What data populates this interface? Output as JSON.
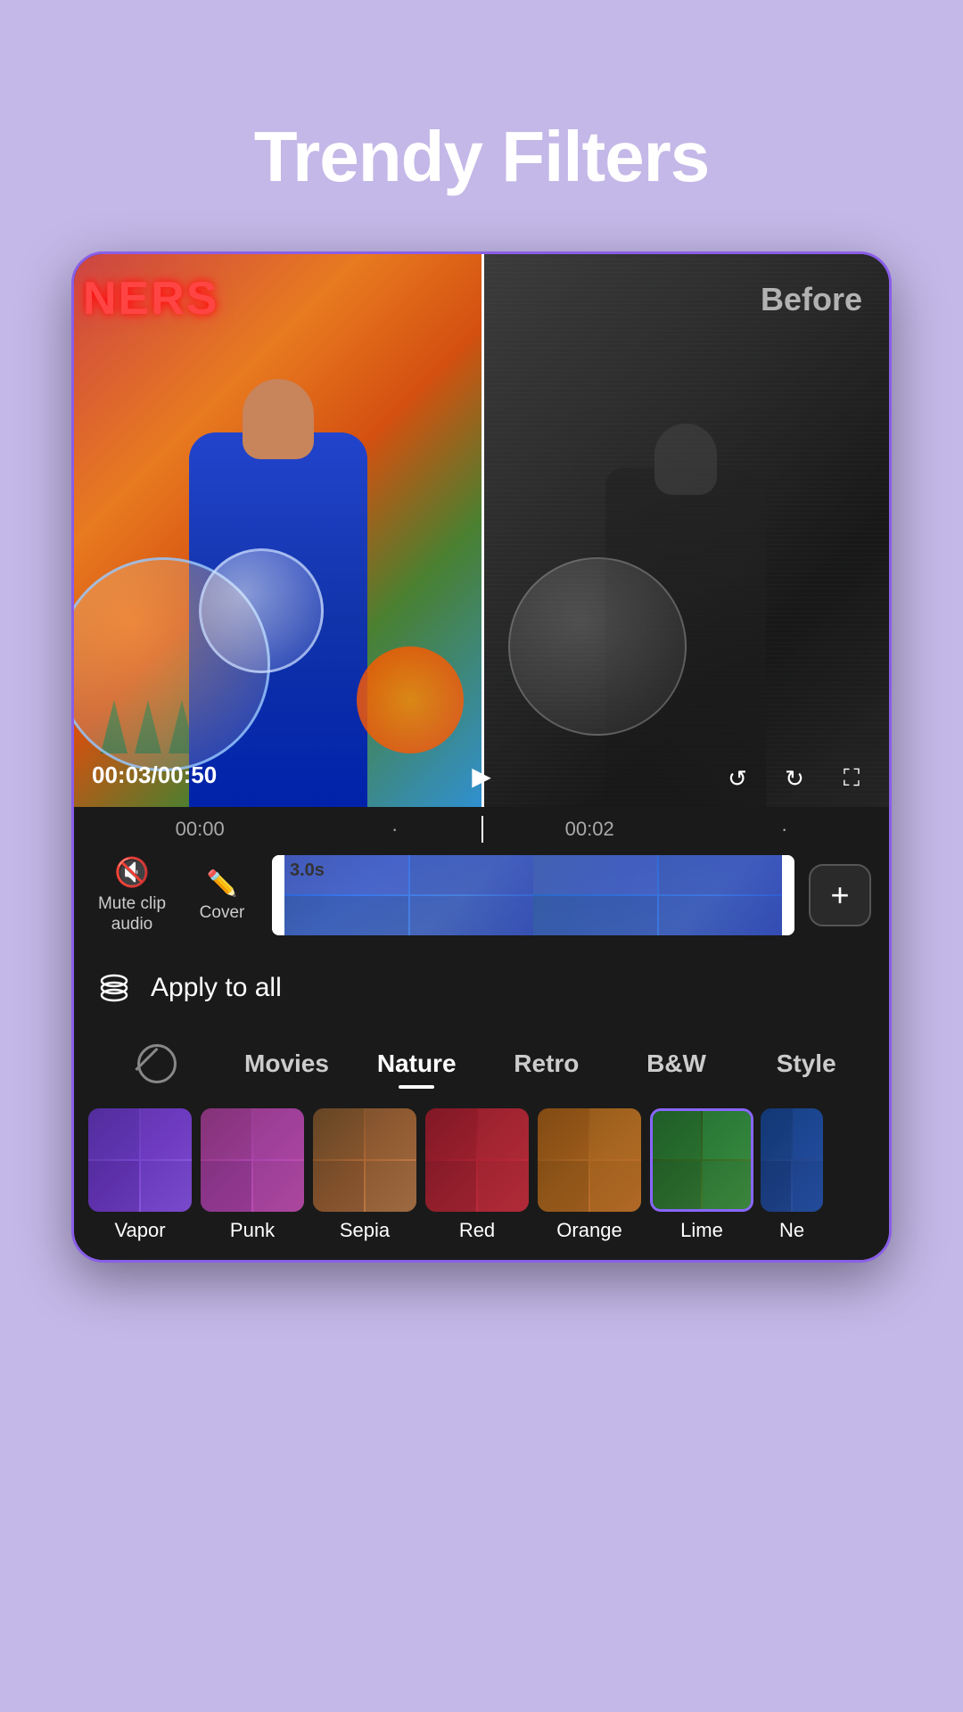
{
  "title": "Trendy Filters",
  "video": {
    "before_label": "Before",
    "timestamp": "00:03/00:50",
    "time_start": "00:00",
    "time_mid": "00:02",
    "clip_duration": "3.0s"
  },
  "timeline": {
    "mute_icon": "🔇",
    "mute_label": "Mute clip\naudio",
    "cover_icon": "✏️",
    "cover_label": "Cover",
    "add_icon": "+",
    "apply_all_label": "Apply to all"
  },
  "filter_tabs": [
    {
      "id": "none",
      "label": ""
    },
    {
      "id": "movies",
      "label": "Movies"
    },
    {
      "id": "nature",
      "label": "Nature",
      "active": true
    },
    {
      "id": "retro",
      "label": "Retro"
    },
    {
      "id": "bw",
      "label": "B&W"
    },
    {
      "id": "style",
      "label": "Style"
    }
  ],
  "filters": [
    {
      "id": "vapor",
      "name": "Vapor",
      "style": "vapor"
    },
    {
      "id": "punk",
      "name": "Punk",
      "style": "punk"
    },
    {
      "id": "sepia",
      "name": "Sepia",
      "style": "sepia"
    },
    {
      "id": "red",
      "name": "Red",
      "style": "red"
    },
    {
      "id": "orange",
      "name": "Orange",
      "style": "orange"
    },
    {
      "id": "lime",
      "name": "Lime",
      "style": "lime",
      "selected": true
    },
    {
      "id": "ne",
      "name": "Ne",
      "style": "ne"
    }
  ]
}
